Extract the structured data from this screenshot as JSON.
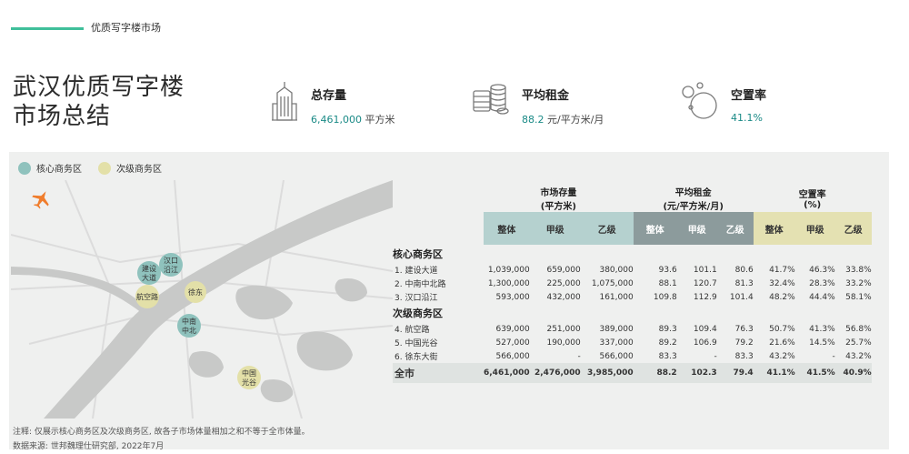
{
  "header": {
    "section_label": "优质写字楼市场"
  },
  "title": {
    "line1": "武汉优质写字楼",
    "line2": "市场总结"
  },
  "kpis": [
    {
      "icon": "building-icon",
      "label": "总存量",
      "value": "6,461,000",
      "unit": "平方米"
    },
    {
      "icon": "coins-icon",
      "label": "平均租金",
      "value": "88.2",
      "unit": "元/平方米/月"
    },
    {
      "icon": "bubbles-icon",
      "label": "空置率",
      "value": "41.1%",
      "unit": ""
    }
  ],
  "legend": {
    "core": "核心商务区",
    "secondary": "次级商务区"
  },
  "colors": {
    "core": "#8fc2bd",
    "secondary": "#e3e0a8",
    "accent": "#3fbf9a",
    "teal_text": "#1a8a86",
    "plane": "#f07d2c"
  },
  "map": {
    "districts": [
      {
        "name_line1": "建设",
        "name_line2": "大道",
        "type": "core"
      },
      {
        "name_line1": "汉口",
        "name_line2": "沿江",
        "type": "core"
      },
      {
        "name_line1": "航空路",
        "name_line2": "",
        "type": "secondary"
      },
      {
        "name_line1": "徐东",
        "name_line2": "",
        "type": "secondary"
      },
      {
        "name_line1": "中南",
        "name_line2": "中北",
        "type": "core"
      },
      {
        "name_line1": "中国",
        "name_line2": "光谷",
        "type": "secondary"
      }
    ]
  },
  "table": {
    "group_headers": [
      {
        "line1": "市场存量",
        "line2": "(平方米)"
      },
      {
        "line1": "平均租金",
        "line2": "(元/平方米/月)"
      },
      {
        "line1": "空置率",
        "line2": "(%)"
      }
    ],
    "sub_headers": [
      "整体",
      "甲级",
      "乙级",
      "整体",
      "甲级",
      "乙级",
      "整体",
      "甲级",
      "乙级"
    ],
    "sections": [
      {
        "title": "核心商务区",
        "rows": [
          {
            "name": "1. 建设大道",
            "values": [
              "1,039,000",
              "659,000",
              "380,000",
              "93.6",
              "101.1",
              "80.6",
              "41.7%",
              "46.3%",
              "33.8%"
            ]
          },
          {
            "name": "2. 中南中北路",
            "values": [
              "1,300,000",
              "225,000",
              "1,075,000",
              "88.1",
              "120.7",
              "81.3",
              "32.4%",
              "28.3%",
              "33.2%"
            ]
          },
          {
            "name": "3. 汉口沿江",
            "values": [
              "593,000",
              "432,000",
              "161,000",
              "109.8",
              "112.9",
              "101.4",
              "48.2%",
              "44.4%",
              "58.1%"
            ]
          }
        ]
      },
      {
        "title": "次级商务区",
        "rows": [
          {
            "name": "4. 航空路",
            "values": [
              "639,000",
              "251,000",
              "389,000",
              "89.3",
              "109.4",
              "76.3",
              "50.7%",
              "41.3%",
              "56.8%"
            ]
          },
          {
            "name": "5. 中国光谷",
            "values": [
              "527,000",
              "190,000",
              "337,000",
              "89.2",
              "106.9",
              "79.2",
              "21.6%",
              "14.5%",
              "25.7%"
            ]
          },
          {
            "name": "6. 徐东大街",
            "values": [
              "566,000",
              "-",
              "566,000",
              "83.3",
              "-",
              "83.3",
              "43.2%",
              "-",
              "43.2%"
            ]
          }
        ]
      }
    ],
    "total": {
      "name": "全市",
      "values": [
        "6,461,000",
        "2,476,000",
        "3,985,000",
        "88.2",
        "102.3",
        "79.4",
        "41.1%",
        "41.5%",
        "40.9%"
      ]
    }
  },
  "notes": {
    "note": "注释: 仅展示核心商务区及次级商务区, 故各子市场体量相加之和不等于全市体量。",
    "source": "数据来源: 世邦魏理仕研究部, 2022年7月"
  }
}
